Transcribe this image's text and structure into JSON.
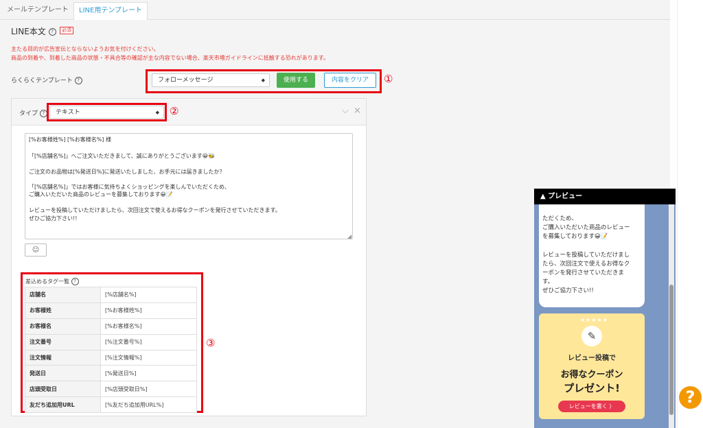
{
  "tabs": [
    {
      "label": "メールテンプレート",
      "active": false
    },
    {
      "label": "LINE用テンプレート",
      "active": true
    }
  ],
  "section": {
    "title": "LINE本文",
    "help": "?",
    "required": "必須",
    "warnings": [
      "主たる目的が広告宣伝とならないようお気を付けください。",
      "商品の到着や、到着した商品の状態・不具合等の確認が主な内容でない場合、楽天市場ガイドラインに抵触する恐れがあります。"
    ]
  },
  "template": {
    "label": "らくらくテンプレート",
    "selected": "フォローメッセージ",
    "use_button": "使用する",
    "clear_button": "内容をクリア",
    "marker": "①"
  },
  "type": {
    "label": "タイプ",
    "selected": "テキスト",
    "marker": "②"
  },
  "message": {
    "lines": [
      "[%お客様姓%] [%お客様名%] 様",
      "",
      "「[%店舗名%]」へご注文いただきまして、誠にありがとうございます😀🐝",
      "",
      "ご注文のお品物は[%発送日%]に発送いたしました、お手元には届きましたか？",
      "",
      "「[%店舗名%]」ではお客様に気持ちよくショッピングを楽しんでいただくため、",
      "ご購入いただいた商品のレビューを募集しております😀📝",
      "",
      "レビューを投稿していただけましたら、次回注文で使えるお得なクーポンを発行させていただきます。",
      "ぜひご協力下さい!!"
    ]
  },
  "tags": {
    "title": "差込めるタグ一覧",
    "marker": "③",
    "rows": [
      {
        "name": "店舗名",
        "tag": "[%店舗名%]"
      },
      {
        "name": "お客様姓",
        "tag": "[%お客様姓%]"
      },
      {
        "name": "お客様名",
        "tag": "[%お客様名%]"
      },
      {
        "name": "注文番号",
        "tag": "[%注文番号%]"
      },
      {
        "name": "注文情報",
        "tag": "[%注文情報%]"
      },
      {
        "name": "発送日",
        "tag": "[%発送日%]"
      },
      {
        "name": "店頭受取日",
        "tag": "[%店頭受取日%]"
      },
      {
        "name": "友だち追加用URL",
        "tag": "[%友だち追加用URL%]"
      }
    ]
  },
  "preview": {
    "header": "▲ プレビュー",
    "lines": [
      "ただくため、",
      "ご購入いただいた商品のレビュー",
      "を募集しております😀📝",
      "",
      "レビューを投稿していただけまし",
      "たら、次回注文で使えるお得なク",
      "ーポンを発行させていただきま",
      "す。",
      "ぜひご協力下さい!!"
    ],
    "coupon": {
      "line1": "レビュー投稿で",
      "line2": "お得なクーポン",
      "line3": "プレゼント!",
      "button": "レビューを書く 〉"
    }
  },
  "help_button": "?",
  "colors": {
    "accent": "#2b9bd4",
    "green": "#4caf50",
    "red": "#e60012",
    "preview_bg": "#7b97c4",
    "coupon_bg": "#ffe79a",
    "help": "#f39800"
  }
}
